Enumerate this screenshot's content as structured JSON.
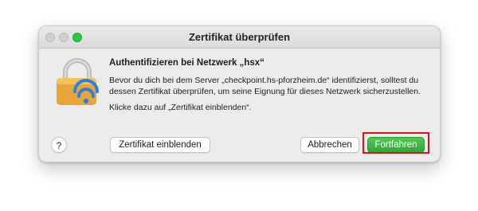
{
  "window": {
    "title": "Zertifikat überprüfen"
  },
  "dialog": {
    "heading": "Authentifizieren bei Netzwerk „hsx“",
    "body": "Bevor du dich bei dem Server „checkpoint.hs-pforzheim.de“ identifizierst, solltest du dessen Zertifikat überprüfen, um seine Eignung für dieses Netzwerk sicherzustellen.",
    "hint": "Klicke dazu auf „Zertifikat einblenden“.",
    "icon": "lock-wifi-icon"
  },
  "buttons": {
    "help": "?",
    "show_certificate": "Zertifikat einblenden",
    "cancel": "Abbrechen",
    "continue": "Fortfahren"
  },
  "colors": {
    "accent_green": "#2ea83a",
    "highlight_red": "#d5141c",
    "lock_gold": "#e9a93a",
    "wifi_blue": "#2f7fe0"
  }
}
